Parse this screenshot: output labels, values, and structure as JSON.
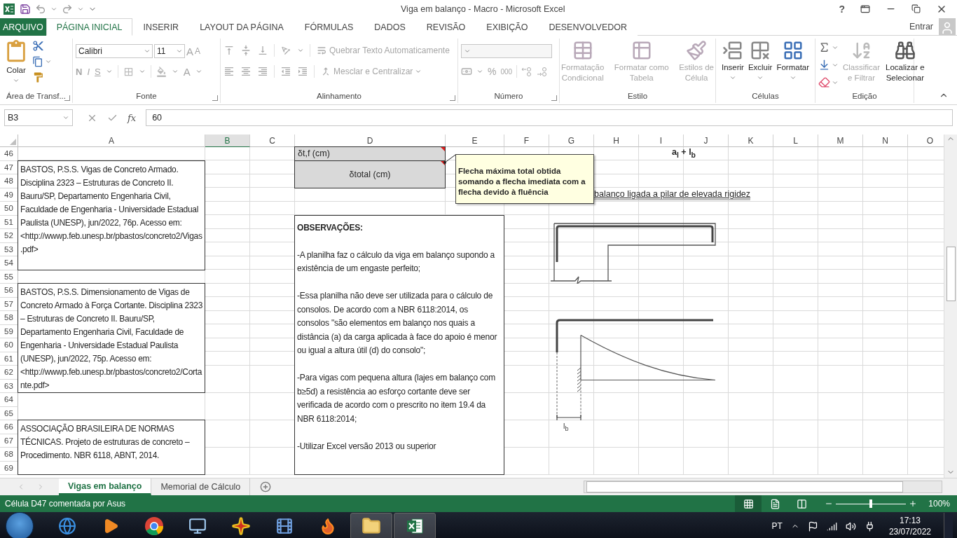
{
  "window": {
    "title": "Viga em balanço - Macro - Microsoft Excel",
    "help": "?"
  },
  "ribbon_tabs": [
    {
      "label": "ARQUIVO",
      "kind": "file",
      "selected": false
    },
    {
      "label": "PÁGINA INICIAL",
      "kind": "tab",
      "selected": true
    },
    {
      "label": "INSERIR",
      "kind": "tab",
      "selected": false
    },
    {
      "label": "LAYOUT DA PÁGINA",
      "kind": "tab",
      "selected": false
    },
    {
      "label": "FÓRMULAS",
      "kind": "tab",
      "selected": false
    },
    {
      "label": "DADOS",
      "kind": "tab",
      "selected": false
    },
    {
      "label": "REVISÃO",
      "kind": "tab",
      "selected": false
    },
    {
      "label": "EXIBIÇÃO",
      "kind": "tab",
      "selected": false
    },
    {
      "label": "DESENVOLVEDOR",
      "kind": "tab",
      "selected": false
    }
  ],
  "account": {
    "label": "Entrar"
  },
  "ribbon": {
    "clipboard": {
      "label": "Área de Transf...",
      "paste": "Colar"
    },
    "font": {
      "label": "Fonte",
      "disabled": true,
      "font_name": "Calibri",
      "font_size": "11",
      "grow": "A",
      "shrink": "A",
      "bold": "N",
      "italic": "I",
      "underline": "S",
      "font_color": "A"
    },
    "alignment": {
      "label": "Alinhamento",
      "disabled": true,
      "wrap": "Quebrar Texto Automaticamente",
      "merge": "Mesclar e Centralizar"
    },
    "number": {
      "label": "Número",
      "disabled": true,
      "percent": "%",
      "thousands": "000"
    },
    "styles": {
      "label": "Estilo",
      "buttons": [
        {
          "lines": [
            "Formatação",
            "Condicional"
          ],
          "disabled": true
        },
        {
          "lines": [
            "Formatar como",
            "Tabela"
          ],
          "disabled": true
        },
        {
          "lines": [
            "Estilos de",
            "Célula"
          ],
          "disabled": true
        }
      ]
    },
    "cells": {
      "label": "Células",
      "buttons": [
        {
          "label": "Inserir"
        },
        {
          "label": "Excluir"
        },
        {
          "label": "Formatar"
        }
      ]
    },
    "editing": {
      "label": "Edição",
      "buttons": [
        {
          "lines": [
            "Classificar",
            "e Filtrar"
          ],
          "disabled": true
        },
        {
          "lines": [
            "Localizar e",
            "Selecionar"
          ],
          "disabled": false
        }
      ]
    }
  },
  "formula_bar": {
    "name_box": "B3",
    "function_label": "fx",
    "value": "60"
  },
  "sheet": {
    "columns": [
      {
        "label": "A",
        "selected": false
      },
      {
        "label": "B",
        "selected": true
      },
      {
        "label": "C",
        "selected": false
      },
      {
        "label": "D",
        "selected": false
      },
      {
        "label": "E",
        "selected": false
      },
      {
        "label": "F",
        "selected": false
      },
      {
        "label": "G",
        "selected": false
      },
      {
        "label": "H",
        "selected": false
      },
      {
        "label": "I",
        "selected": false
      },
      {
        "label": "J",
        "selected": false
      },
      {
        "label": "K",
        "selected": false
      },
      {
        "label": "L",
        "selected": false
      },
      {
        "label": "M",
        "selected": false
      },
      {
        "label": "N",
        "selected": false
      },
      {
        "label": "O",
        "selected": false
      }
    ],
    "rows": [
      "46",
      "47",
      "48",
      "49",
      "50",
      "51",
      "52",
      "53",
      "54",
      "55",
      "56",
      "57",
      "58",
      "59",
      "60",
      "61",
      "62",
      "63",
      "64",
      "65",
      "66",
      "67",
      "68",
      "69"
    ],
    "cells": [
      {
        "kind": "label",
        "text": "δt,f (cm)",
        "commented": true
      },
      {
        "kind": "label",
        "text": "δtotal (cm)",
        "commented": true
      },
      {
        "kind": "formula",
        "text": "a$_{l}$ + l$_{b}$"
      },
      {
        "kind": "reference",
        "text": "BASTOS, P.S.S. Vigas de Concreto Armado. Disciplina 2323 – Estruturas de Concreto II. Bauru/SP, Departamento Engenharia Civil, Faculdade de Engenharia - Universidade Estadual Paulista (UNESP), jun/2022, 76p. Acesso em: <http://wwwp.feb.unesp.br/pbastos/concreto2/Vigas.pdf>"
      },
      {
        "kind": "reference",
        "text": "BASTOS, P.S.S. Dimensionamento de Vigas de Concreto Armado à Força Cortante. Disciplina 2323 – Estruturas de Concreto II. Bauru/SP, Departamento Engenharia Civil, Faculdade de Engenharia - Universidade Estadual Paulista (UNESP), jun/2022, 75p. Acesso em: <http://wwwp.feb.unesp.br/pbastos/concreto2/Cortante.pdf>"
      },
      {
        "kind": "reference",
        "text": "ASSOCIAÇÃO BRASILEIRA DE NORMAS TÉCNICAS. Projeto de estruturas de concreto – Procedimento. NBR 6118, ABNT, 2014."
      },
      {
        "kind": "caption",
        "text": "balanço ligada a pilar de elevada rigidez"
      },
      {
        "kind": "notes",
        "title": "OBSERVAÇÕES:",
        "paragraphs": [
          "-A planilha faz o cálculo da viga em balanço supondo a existência de um engaste perfeito;",
          "-Essa planilha não deve ser utilizada para o cálculo de consolos. De acordo com a NBR 6118:2014, os consolos \"são elementos em balanço nos quais a distância (a) da carga aplicada à face do apoio é menor ou igual a altura útil (d) do consolo\";",
          "-Para vigas com pequena altura (lajes em balanço com b≥5d) a resistência ao esforço cortante deve ser verificada de acordo com o prescrito no item 19.4 da NBR 6118:2014;",
          "-Utilizar Excel versão 2013 ou superior"
        ]
      }
    ],
    "comment": {
      "text": "Flecha máxima total obtida somando a flecha imediata com a flecha devido à fluência"
    },
    "figures": [
      {
        "kind": "beam_section"
      },
      {
        "kind": "anchorage",
        "label": "l$_{b}$"
      }
    ]
  },
  "sheet_tabs": [
    {
      "label": "Vigas em balanço",
      "selected": true
    },
    {
      "label": "Memorial de Cálculo",
      "selected": false
    }
  ],
  "status_bar": {
    "message": "Célula D47 comentada por Asus",
    "views": [
      {
        "kind": "normal",
        "selected": true
      },
      {
        "kind": "page_layout",
        "selected": false
      },
      {
        "kind": "page_break",
        "selected": false
      }
    ],
    "zoom": {
      "level": 0.5,
      "reading": "100%"
    }
  },
  "taskbar": {
    "apps": [
      {
        "kind": "ie",
        "open": false
      },
      {
        "kind": "media",
        "open": false
      },
      {
        "kind": "chrome",
        "open": false
      },
      {
        "kind": "remote",
        "open": false
      },
      {
        "kind": "star",
        "open": false
      },
      {
        "kind": "video",
        "open": false
      },
      {
        "kind": "firefox",
        "open": false
      },
      {
        "kind": "explorer",
        "open": true
      },
      {
        "kind": "excel",
        "open": true
      }
    ],
    "language": "PT",
    "time": "17:13",
    "date": "23/07/2022"
  }
}
